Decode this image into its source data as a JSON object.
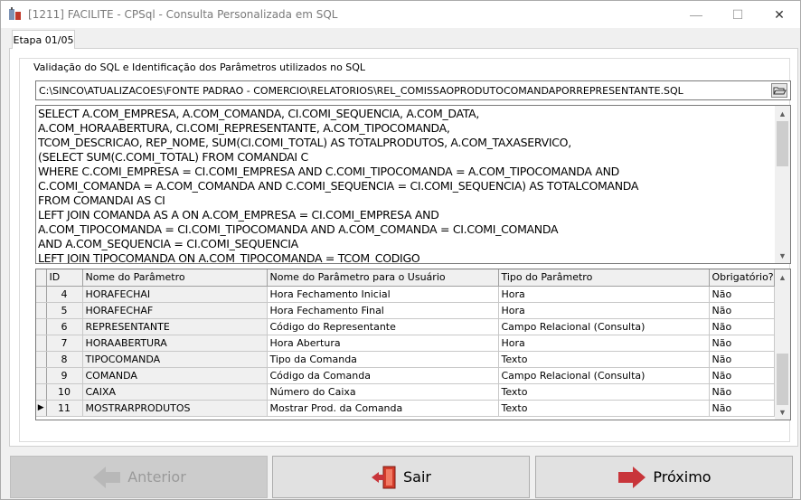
{
  "window": {
    "title": "[1211] FACILITE - CPSql - Consulta Personalizada em SQL",
    "min_glyph": "—",
    "max_glyph": "☐",
    "close_glyph": "✕"
  },
  "tab": {
    "label": "Etapa 01/05"
  },
  "group": {
    "legend": "Validação do SQL e Identificação dos Parâmetros utilizados no SQL"
  },
  "file": {
    "path": "C:\\SINCO\\ATUALIZACOES\\FONTE PADRAO - COMERCIO\\RELATORIOS\\REL_COMISSAOPRODUTOCOMANDAPORREPRESENTANTE.SQL"
  },
  "sql": {
    "text": "SELECT A.COM_EMPRESA, A.COM_COMANDA, CI.COMI_SEQUENCIA, A.COM_DATA,\nA.COM_HORAABERTURA, CI.COMI_REPRESENTANTE, A.COM_TIPOCOMANDA,\nTCOM_DESCRICAO, REP_NOME, SUM(CI.COMI_TOTAL) AS TOTALPRODUTOS, A.COM_TAXASERVICO,\n(SELECT SUM(C.COMI_TOTAL) FROM COMANDAI C\nWHERE C.COMI_EMPRESA = CI.COMI_EMPRESA AND C.COMI_TIPOCOMANDA = A.COM_TIPOCOMANDA AND\nC.COMI_COMANDA = A.COM_COMANDA AND C.COMI_SEQUENCIA = CI.COMI_SEQUENCIA) AS TOTALCOMANDA\nFROM COMANDAI AS CI\nLEFT JOIN COMANDA AS A ON A.COM_EMPRESA = CI.COMI_EMPRESA AND\nA.COM_TIPOCOMANDA = CI.COMI_TIPOCOMANDA AND A.COM_COMANDA = CI.COMI_COMANDA\nAND A.COM_SEQUENCIA = CI.COMI_SEQUENCIA\nLEFT JOIN TIPOCOMANDA ON A.COM_TIPOCOMANDA = TCOM_CODIGO"
  },
  "grid": {
    "headers": {
      "id": "ID",
      "nome": "Nome do Parâmetro",
      "nome_usuario": "Nome do Parâmetro para o Usuário",
      "tipo": "Tipo do Parâmetro",
      "obrigatorio": "Obrigatório?"
    },
    "current_row_marker": "▶",
    "rows": [
      {
        "id": "4",
        "nome": "HORAFECHAI",
        "nome_usuario": "Hora Fechamento Inicial",
        "tipo": "Hora",
        "obrigatorio": "Não"
      },
      {
        "id": "5",
        "nome": "HORAFECHAF",
        "nome_usuario": "Hora Fechamento Final",
        "tipo": "Hora",
        "obrigatorio": "Não"
      },
      {
        "id": "6",
        "nome": "REPRESENTANTE",
        "nome_usuario": "Código do Representante",
        "tipo": "Campo Relacional (Consulta)",
        "obrigatorio": "Não"
      },
      {
        "id": "7",
        "nome": "HORAABERTURA",
        "nome_usuario": "Hora Abertura",
        "tipo": "Hora",
        "obrigatorio": "Não"
      },
      {
        "id": "8",
        "nome": "TIPOCOMANDA",
        "nome_usuario": "Tipo da Comanda",
        "tipo": "Texto",
        "obrigatorio": "Não"
      },
      {
        "id": "9",
        "nome": "COMANDA",
        "nome_usuario": "Código da Comanda",
        "tipo": "Campo Relacional (Consulta)",
        "obrigatorio": "Não"
      },
      {
        "id": "10",
        "nome": "CAIXA",
        "nome_usuario": "Número do Caixa",
        "tipo": "Texto",
        "obrigatorio": "Não"
      },
      {
        "id": "11",
        "nome": "MOSTRARPRODUTOS",
        "nome_usuario": "Mostrar Prod. da Comanda",
        "tipo": "Texto",
        "obrigatorio": "Não"
      }
    ]
  },
  "buttons": {
    "anterior": "Anterior",
    "sair": "Sair",
    "proximo": "Próximo"
  },
  "colors": {
    "arrow_disabled": "#b8b8b8",
    "arrow_red": "#c8353a",
    "door_red": "#d23b2a"
  }
}
